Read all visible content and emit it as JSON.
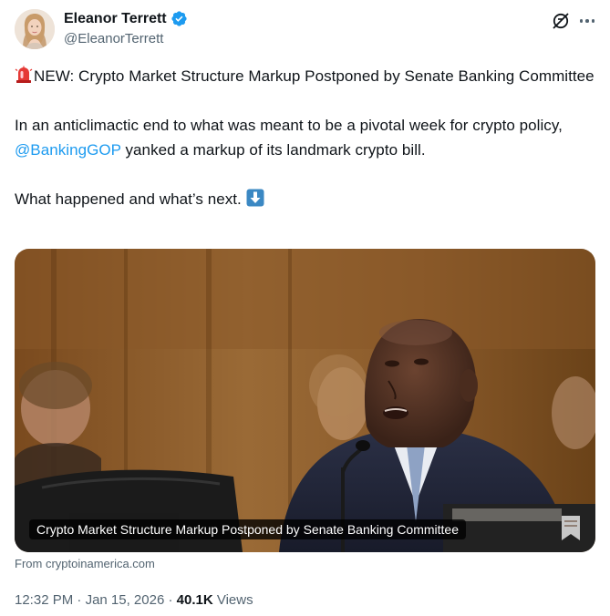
{
  "author": {
    "display_name": "Eleanor Terrett",
    "handle": "@EleanorTerrett",
    "verified": true,
    "verified_color": "#1d9bf0"
  },
  "header_icons": [
    "grok-icon",
    "more-icon"
  ],
  "tweet": {
    "line1_emoji": "rotating-light-emoji",
    "line1_text": "NEW: Crypto Market Structure Markup Postponed by Senate Banking Committee",
    "para2_before": "In an anticlimactic end to what was meant to be a pivotal week for crypto policy, ",
    "para2_mention": "@BankingGOP",
    "para2_after": " yanked a markup of its landmark crypto bill.",
    "para3_text": "What happened and what’s next. ",
    "para3_emoji": "down-arrow-emoji"
  },
  "card": {
    "caption": "Crypto Market Structure Markup Postponed by Senate Banking Committee",
    "source": "From cryptoinamerica.com"
  },
  "meta": {
    "time": "12:32 PM",
    "separator": "·",
    "date": "Jan 15, 2026",
    "views_count": "40.1K",
    "views_label": "Views"
  },
  "colors": {
    "text": "#0f1419",
    "secondary": "#536471",
    "link": "#1d9bf0"
  }
}
